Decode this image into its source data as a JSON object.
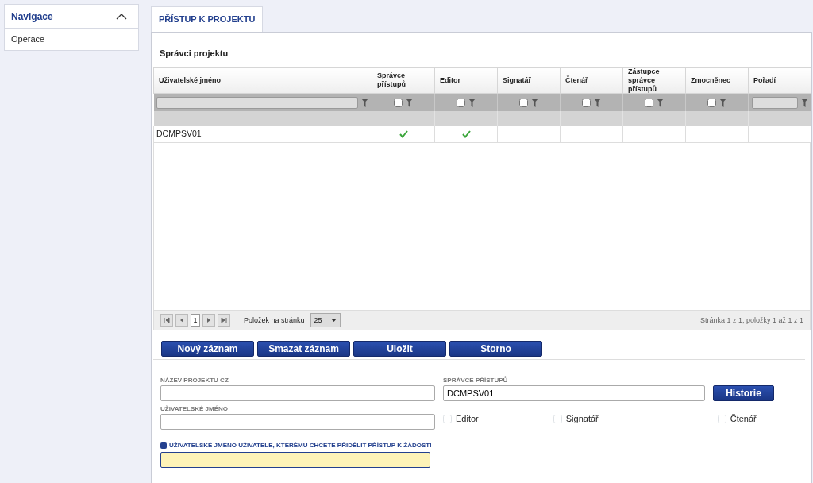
{
  "sidebar": {
    "title": "Navigace",
    "expanded": true,
    "items": [
      {
        "label": "Operace"
      }
    ]
  },
  "tabs": [
    {
      "label": "PŘÍSTUP K PROJEKTU",
      "selected": true
    }
  ],
  "grid": {
    "title": "Správci projektu",
    "columns": [
      {
        "label": "Uživatelské jméno",
        "kind": "text"
      },
      {
        "label": "Správce přístupů",
        "kind": "check",
        "filter_checked": false
      },
      {
        "label": "Editor",
        "kind": "check",
        "filter_checked": false
      },
      {
        "label": "Signatář",
        "kind": "check",
        "filter_checked": false
      },
      {
        "label": "Čtenář",
        "kind": "check",
        "filter_checked": false
      },
      {
        "label": "Zástupce správce přístupů",
        "kind": "check",
        "filter_checked": false
      },
      {
        "label": "Zmocněnec",
        "kind": "check",
        "filter_checked": false
      },
      {
        "label": "Pořadí",
        "kind": "text"
      }
    ],
    "rows": [
      {
        "username": "DCMPSV01",
        "checks": [
          true,
          true,
          false,
          false,
          false,
          false
        ]
      }
    ]
  },
  "pager": {
    "page": "1",
    "page_size_label": "Položek na stránku",
    "page_size": "25",
    "summary": "Stránka 1 z 1, položky 1 až 1 z 1"
  },
  "buttons": [
    "Nový záznam",
    "Smazat záznam",
    "Uložit",
    "Storno"
  ],
  "form": {
    "project_name": {
      "label": "NÁZEV PROJEKTU CZ"
    },
    "admin": {
      "label": "SPRÁVCE PŘÍSTUPŮ",
      "value": "DCMPSV01"
    },
    "history_button": "Historie",
    "username": {
      "label": "UŽIVATELSKÉ JMÉNO"
    },
    "roles": [
      {
        "label": "Editor",
        "checked": false
      },
      {
        "label": "Signatář",
        "checked": false
      },
      {
        "label": "Čtenář",
        "checked": false
      }
    ],
    "grant": {
      "label": "UŽIVATELSKÉ JMÉNO UŽIVATELE, KTERÉMU CHCETE PŘIDĚLIT PŘÍSTUP K ŽÁDOSTI",
      "required": true
    }
  }
}
